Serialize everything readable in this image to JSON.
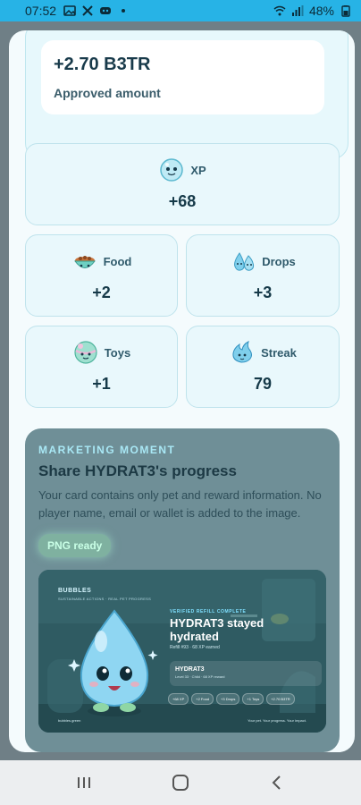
{
  "status_bar": {
    "time": "07:52",
    "battery": "48%",
    "icons": [
      "gallery-icon",
      "x-icon",
      "discord-icon",
      "dot-icon",
      "wifi-icon",
      "signal-icon",
      "battery-icon"
    ]
  },
  "approved": {
    "amount": "+2.70 B3TR",
    "label": "Approved amount"
  },
  "stats": {
    "xp": {
      "label": "XP",
      "value": "+68",
      "icon": "xp-bubble-icon"
    },
    "food": {
      "label": "Food",
      "value": "+2",
      "icon": "food-bowl-icon"
    },
    "drops": {
      "label": "Drops",
      "value": "+3",
      "icon": "drops-icon"
    },
    "toys": {
      "label": "Toys",
      "value": "+1",
      "icon": "toy-ball-icon"
    },
    "streak": {
      "label": "Streak",
      "value": "79",
      "icon": "streak-icon"
    }
  },
  "marketing": {
    "tag": "MARKETING MOMENT",
    "title": "Share HYDRAT3's progress",
    "description": "Your card contains only pet and reward information. No player name, email or wallet is added to the image.",
    "png_status": "PNG ready"
  },
  "share_image": {
    "brand": "BUBBLES",
    "brand_sub": "SUSTAINABLE ACTIONS · REAL PET PROGRESS",
    "verified": "VERIFIED REFILL COMPLETE",
    "title": "HYDRAT3 stayed hydrated",
    "refill": "Refill #93 · 68 XP earned",
    "pet_name": "HYDRAT3",
    "pet_level": "Level 33 · Child · 68 XP reward",
    "chips": [
      "+68 XP",
      "+2 Food",
      "+3 Drops",
      "+1 Toys",
      "+2.70 B3TR"
    ],
    "footer_left": "bubbles.green",
    "footer_right": "Your pet. Your progress. Your impact."
  },
  "colors": {
    "status_bar": "#27b3e6",
    "sheet": "#f4fbfd",
    "card": "#e9f8fc",
    "accent_text": "#163a49"
  }
}
